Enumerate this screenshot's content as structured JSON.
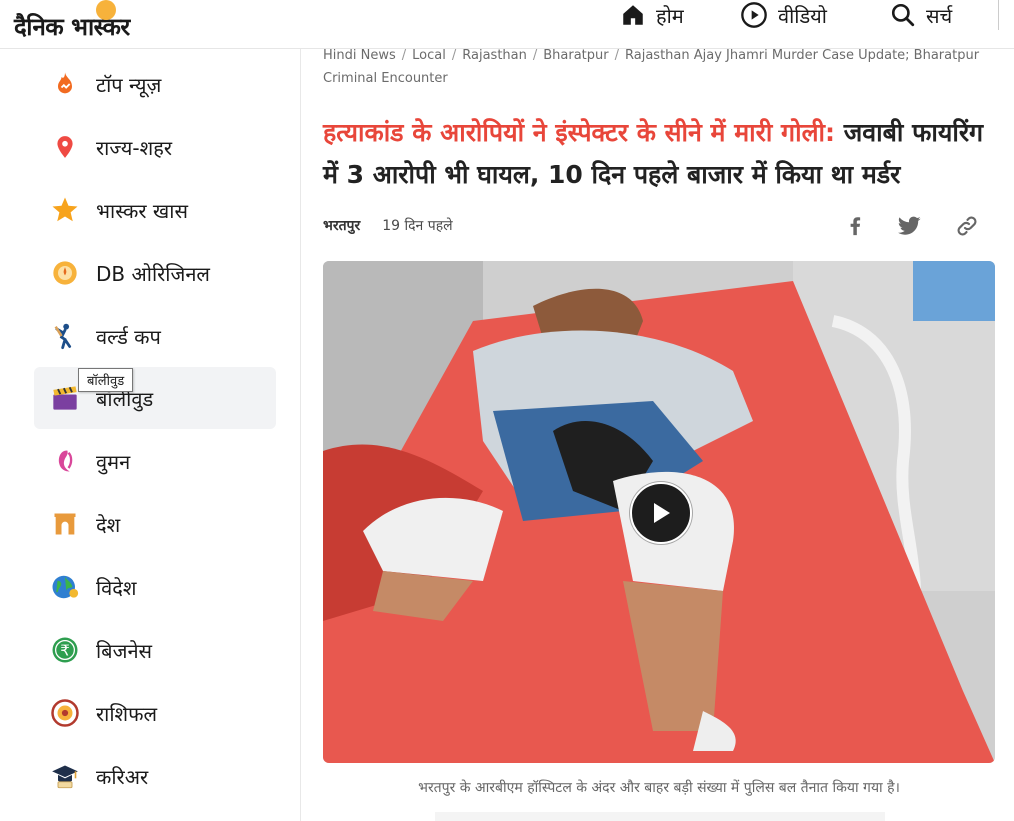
{
  "header": {
    "logo_text": "दैनिक भास्कर",
    "nav": [
      {
        "label": "होम",
        "icon": "home-icon"
      },
      {
        "label": "वीडियो",
        "icon": "play-circle-icon"
      },
      {
        "label": "सर्च",
        "icon": "search-icon"
      }
    ]
  },
  "sidebar": {
    "items": [
      {
        "label": "टॉप न्यूज़",
        "icon": "flame-icon"
      },
      {
        "label": "राज्य-शहर",
        "icon": "location-pin-icon"
      },
      {
        "label": "भास्कर खास",
        "icon": "star-icon"
      },
      {
        "label": "DB ओरिजिनल",
        "icon": "db-original-icon"
      },
      {
        "label": "वर्ल्ड कप",
        "icon": "cricket-player-icon"
      },
      {
        "label": "बॉलीवुड",
        "icon": "clapperboard-icon",
        "active": true
      },
      {
        "label": "वुमन",
        "icon": "woman-icon"
      },
      {
        "label": "देश",
        "icon": "india-gate-icon"
      },
      {
        "label": "विदेश",
        "icon": "globe-icon"
      },
      {
        "label": "बिजनेस",
        "icon": "rupee-icon"
      },
      {
        "label": "राशिफल",
        "icon": "zodiac-icon"
      },
      {
        "label": "करिअर",
        "icon": "graduation-cap-icon"
      }
    ],
    "tooltip": "बॉलीवुड"
  },
  "breadcrumb": {
    "items": [
      "Hindi News",
      "Local",
      "Rajasthan",
      "Bharatpur",
      "Rajasthan Ajay Jhamri Murder Case Update; Bharatpur Criminal Encounter"
    ]
  },
  "article": {
    "headline_highlight": "हत्याकांड के आरोपियों ने इंस्पेक्टर के सीने में मारी गोली:",
    "headline_rest": " जवाबी फायरिंग में 3 आरोपी भी घायल, 10 दिन पहले बाजार में किया था मर्डर",
    "city": "भरतपुर",
    "time": "19 दिन पहले",
    "caption": "भरतपुर के आरबीएम हॉस्पिटल के अंदर और बाहर बड़ी संख्या में पुलिस बल तैनात किया गया है।"
  },
  "colors": {
    "accent_red": "#e8463a",
    "media_sheet": "#e8584f",
    "active_bg": "#f2f3f5"
  }
}
